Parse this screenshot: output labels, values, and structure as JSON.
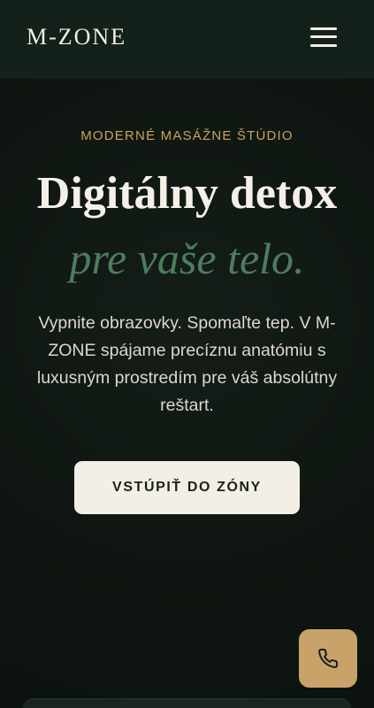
{
  "header": {
    "logo": "M-ZONE",
    "menu_icon": "hamburger-menu-icon"
  },
  "hero": {
    "eyebrow": "MODERNÉ MASÁŽNE ŠTÚDIO",
    "headline": "Digitálny detox",
    "headline_accent": "pre vaše telo.",
    "lead": "Vypnite obrazovky. Spomaľte tep. V M-ZONE spájame precíznu anatómiu s luxusným prostredím pre váš absolútny reštart.",
    "cta_label": "VSTÚPIŤ DO ZÓNY"
  },
  "floating": {
    "phone_icon": "phone-icon"
  },
  "colors": {
    "background": "#101712",
    "header": "#14201a",
    "gold": "#c9a25f",
    "green_accent": "#4d7c5f",
    "cta_background": "#f4efe6"
  }
}
